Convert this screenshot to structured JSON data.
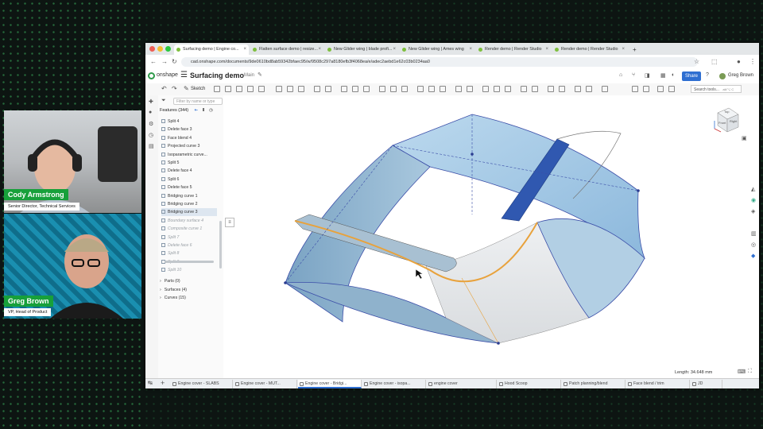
{
  "browser": {
    "tabs": [
      {
        "label": "Surfacing demo | Engine co..."
      },
      {
        "label": "Flatten surface demo | resize..."
      },
      {
        "label": "New Glider wing | blade profi..."
      },
      {
        "label": "New Glider wing | Ames wing"
      },
      {
        "label": "Render demo | Render Studio"
      },
      {
        "label": "Render demo | Render Studio"
      }
    ],
    "new_tab": "+",
    "url": "cad.onshape.com/documents/9de0610bd8ab59342bfaec95/w/9508c297a8180efb3f4068ea/e/adec2aebd1e62c03b0234aa0"
  },
  "app": {
    "logo": "onshape",
    "document_title": "Surfacing demo",
    "branch": "Main",
    "share_label": "Share",
    "user_name": "Greg Brown",
    "search_tools": "Search tools...",
    "search_shortcut": "alt/⌥ C",
    "sketch_label": "Sketch"
  },
  "feature_panel": {
    "filter_placeholder": "Filter by name or type",
    "header": "Features (344)",
    "features": [
      {
        "label": "Split 4",
        "state": "normal"
      },
      {
        "label": "Delete face 3",
        "state": "normal"
      },
      {
        "label": "Face blend 4",
        "state": "normal"
      },
      {
        "label": "Projected curve 3",
        "state": "normal"
      },
      {
        "label": "Isoparametric curve...",
        "state": "normal"
      },
      {
        "label": "Split 5",
        "state": "normal"
      },
      {
        "label": "Delete face 4",
        "state": "normal"
      },
      {
        "label": "Split 6",
        "state": "normal"
      },
      {
        "label": "Delete face 5",
        "state": "normal"
      },
      {
        "label": "Bridging curve 1",
        "state": "normal"
      },
      {
        "label": "Bridging curve 2",
        "state": "normal"
      },
      {
        "label": "Bridging curve 3",
        "state": "selected"
      },
      {
        "label": "Boundary surface 4",
        "state": "dim"
      },
      {
        "label": "Composite curve 1",
        "state": "dim"
      },
      {
        "label": "Split 7",
        "state": "dim"
      },
      {
        "label": "Delete face 6",
        "state": "dim"
      },
      {
        "label": "Split 8",
        "state": "dim"
      },
      {
        "label": "Split 9",
        "state": "dim"
      },
      {
        "label": "Split 10",
        "state": "dim"
      }
    ],
    "groups": [
      {
        "label": "Parts (0)"
      },
      {
        "label": "Surfaces (4)"
      },
      {
        "label": "Curves (15)"
      }
    ]
  },
  "view_cube": {
    "top": "Top",
    "front": "Front",
    "right": "Right"
  },
  "status": {
    "length": "Length: 34.648 mm"
  },
  "bottom_tabs": [
    {
      "label": "Engine cover - SLABS",
      "active": false
    },
    {
      "label": "Engine cover - MUT...",
      "active": false
    },
    {
      "label": "Engine cover - Bridgi...",
      "active": true
    },
    {
      "label": "Engine cover - isopa...",
      "active": false
    },
    {
      "label": "engine cover",
      "active": false
    },
    {
      "label": "Hood Scoop",
      "active": false
    },
    {
      "label": "Patch planning/blend",
      "active": false
    },
    {
      "label": "Face blend / trim",
      "active": false
    },
    {
      "label": "JD",
      "active": false
    }
  ],
  "participants": [
    {
      "name": "Cody Armstrong",
      "role": "Senior Director, Technical Services"
    },
    {
      "name": "Greg Brown",
      "role": "VP, Head of Product"
    }
  ],
  "colors": {
    "brand_green": "#17a03a",
    "accent_blue": "#2f6fd1",
    "surface_blue": "#9cc4e4",
    "curve_orange": "#e8a23c"
  }
}
